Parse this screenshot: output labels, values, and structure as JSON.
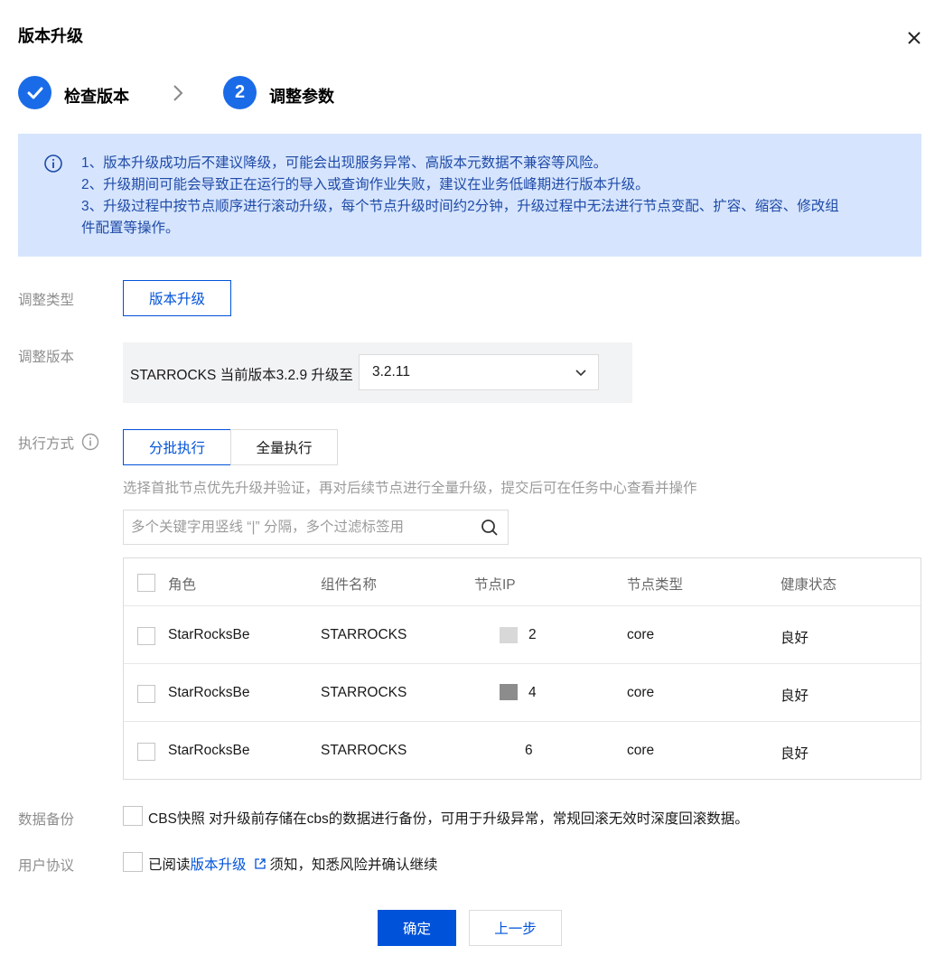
{
  "dialog": {
    "title": "版本升级",
    "close_icon": "close-icon"
  },
  "steps": [
    {
      "label": "检查版本",
      "status": "done",
      "icon": "check-icon"
    },
    {
      "label": "调整参数",
      "status": "active",
      "number": "2"
    }
  ],
  "alert": {
    "icon": "info-circle-icon",
    "lines": [
      "1、版本升级成功后不建议降级，可能会出现服务异常、高版本元数据不兼容等风险。",
      "2、升级期间可能会导致正在运行的导入或查询作业失败，建议在业务低峰期进行版本升级。",
      "3、升级过程中按节点顺序进行滚动升级，每个节点升级时间约2分钟，升级过程中无法进行节点变配、扩容、缩容、修改组",
      "件配置等操作。"
    ]
  },
  "adjust_type": {
    "label": "调整类型",
    "value": "版本升级"
  },
  "adjust_version": {
    "label": "调整版本",
    "text": "STARROCKS 当前版本3.2.9 升级至",
    "selected": "3.2.11"
  },
  "exec_mode": {
    "label": "执行方式",
    "options": [
      "分批执行",
      "全量执行"
    ],
    "selected": "分批执行",
    "hint": "选择首批节点优先升级并验证，再对后续节点进行全量升级，提交后可在任务中心查看并操作"
  },
  "search": {
    "placeholder": "多个关键字用竖线 “|” 分隔，多个过滤标签用"
  },
  "table": {
    "columns": [
      "角色",
      "组件名称",
      "节点IP",
      "节点类型",
      "健康状态"
    ],
    "rows": [
      {
        "role": "StarRocksBe",
        "component": "STARROCKS",
        "ip": "2",
        "type": "core",
        "health": "良好"
      },
      {
        "role": "StarRocksBe",
        "component": "STARROCKS",
        "ip": "4",
        "type": "core",
        "health": "良好"
      },
      {
        "role": "StarRocksBe",
        "component": "STARROCKS",
        "ip": "6",
        "type": "core",
        "health": "良好"
      }
    ]
  },
  "backup": {
    "label": "数据备份",
    "text": "CBS快照 对升级前存储在cbs的数据进行备份，可用于升级异常，常规回滚无效时深度回滚数据。"
  },
  "agreement": {
    "label": "用户协议",
    "prefix": "已阅读",
    "link": "版本升级",
    "suffix": "须知，知悉风险并确认继续"
  },
  "footer": {
    "confirm": "确定",
    "prev": "上一步"
  },
  "colors": {
    "primary": "#0052d9",
    "step": "#1a6be8",
    "alert_bg": "#d6e5fd"
  }
}
